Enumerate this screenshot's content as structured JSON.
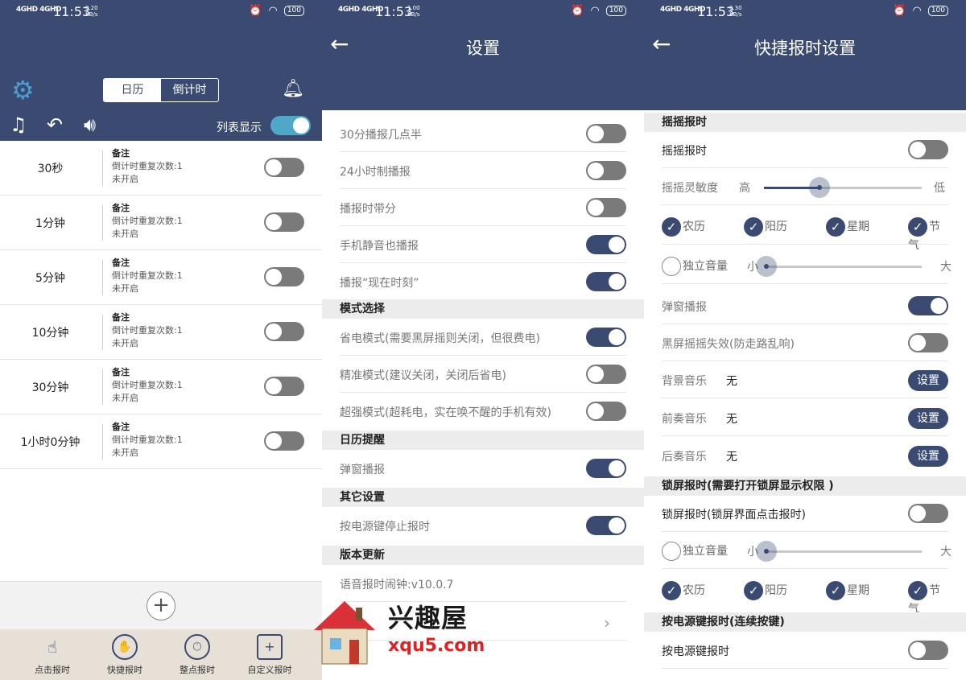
{
  "status_bars": [
    {
      "signal": "4GHD 4GHD",
      "time": "11:53",
      "speed": "0.20\nKB/s",
      "battery": "100"
    },
    {
      "signal": "4GHD 4GHD",
      "time": "11:53",
      "speed": "1.00\nKB/s",
      "battery": "100"
    },
    {
      "signal": "4GHD 4GHD",
      "time": "11:53",
      "speed": "0.30\nKB/s",
      "battery": "100"
    }
  ],
  "screen1": {
    "tabs": [
      "日历",
      "倒计时"
    ],
    "list_display_label": "列表显示",
    "timers": [
      {
        "name": "30秒",
        "note": "备注",
        "repeat": "倒计时重复次数:1",
        "status": "未开启"
      },
      {
        "name": "1分钟",
        "note": "备注",
        "repeat": "倒计时重复次数:1",
        "status": "未开启"
      },
      {
        "name": "5分钟",
        "note": "备注",
        "repeat": "倒计时重复次数:1",
        "status": "未开启"
      },
      {
        "name": "10分钟",
        "note": "备注",
        "repeat": "倒计时重复次数:1",
        "status": "未开启"
      },
      {
        "name": "30分钟",
        "note": "备注",
        "repeat": "倒计时重复次数:1",
        "status": "未开启"
      },
      {
        "name": "1小时0分钟",
        "note": "备注",
        "repeat": "倒计时重复次数:1",
        "status": "未开启"
      }
    ],
    "add_label": "+",
    "bottom_nav": [
      "点击报时",
      "快捷报时",
      "整点报时",
      "自定义报时"
    ]
  },
  "screen2": {
    "title": "设置",
    "rows": [
      {
        "label": "30分播报几点半",
        "on": false
      },
      {
        "label": "24小时制播报",
        "on": false
      },
      {
        "label": "播报时带分",
        "on": false
      },
      {
        "label": "手机静音也播报",
        "on": true
      },
      {
        "label": "播报“现在时刻”",
        "on": true
      }
    ],
    "sections": {
      "mode": "模式选择",
      "calendar": "日历提醒",
      "other": "其它设置",
      "version": "版本更新"
    },
    "mode_rows": [
      {
        "label": "省电模式(需要黑屏摇则关闭，但很费电)",
        "on": true
      },
      {
        "label": "精准模式(建议关闭，关闭后省电)",
        "on": false
      },
      {
        "label": "超强模式(超耗电，实在唤不醒的手机有效)",
        "on": false
      }
    ],
    "calendar_row": {
      "label": "弹窗播报",
      "on": true
    },
    "other_row": {
      "label": "按电源键停止报时",
      "on": true
    },
    "version_text": "语音报时闹钟:v10.0.7"
  },
  "screen3": {
    "title": "快捷报时设置",
    "sec_shake": "摇摇报时",
    "shake_toggle": "摇摇报时",
    "sensitivity_label": "摇摇灵敏度",
    "sensitivity_high": "高",
    "sensitivity_low": "低",
    "sensitivity_value": 0.35,
    "checks": [
      "农历",
      "阳历",
      "星期",
      "节气"
    ],
    "volume_label": "独立音量",
    "volume_small": "小",
    "volume_big": "大",
    "popup_label": "弹窗播报",
    "blackscreen_label": "黑屏摇摇失效(防走路乱响)",
    "music_rows": [
      {
        "label": "背景音乐",
        "value": "无",
        "btn": "设置"
      },
      {
        "label": "前奏音乐",
        "value": "无",
        "btn": "设置"
      },
      {
        "label": "后奏音乐",
        "value": "无",
        "btn": "设置"
      }
    ],
    "sec_lock": "锁屏报时(需要打开锁屏显示权限 )",
    "lock_toggle": "锁屏报时(锁屏界面点击报时)",
    "sec_power": "按电源键报时(连续按键)",
    "power_toggle": "按电源键报时"
  },
  "watermark": {
    "cn": "兴趣屋",
    "url": "xqu5.com"
  }
}
